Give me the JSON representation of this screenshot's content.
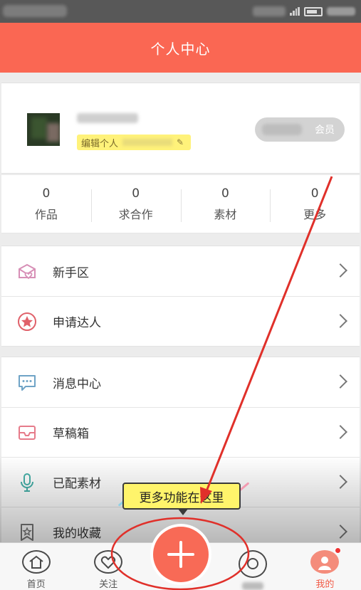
{
  "header": {
    "title": "个人中心"
  },
  "profile": {
    "member_label": "会员",
    "signature_prefix": "编辑个人"
  },
  "stats": [
    {
      "value": "0",
      "label": "作品"
    },
    {
      "value": "0",
      "label": "求合作"
    },
    {
      "value": "0",
      "label": "素材"
    },
    {
      "value": "0",
      "label": "更多"
    }
  ],
  "menu_group_1": [
    {
      "label": "新手区",
      "icon": "gift-box-heart-icon"
    },
    {
      "label": "申请达人",
      "icon": "star-badge-icon"
    }
  ],
  "menu_group_2": [
    {
      "label": "消息中心",
      "icon": "chat-bubble-icon"
    },
    {
      "label": "草稿箱",
      "icon": "inbox-tray-icon"
    },
    {
      "label": "已配素材",
      "icon": "microphone-icon"
    },
    {
      "label": "我的收藏",
      "icon": "bookmark-star-icon"
    }
  ],
  "tooltip": {
    "text": "更多功能在这里"
  },
  "tabbar": {
    "tabs": [
      {
        "label": "首页",
        "icon": "home-icon"
      },
      {
        "label": "关注",
        "icon": "heart-icon"
      },
      {
        "label": "",
        "icon": "plus-icon"
      },
      {
        "label": "",
        "icon": "circle-icon"
      },
      {
        "label": "我的",
        "icon": "profile-avatar-icon"
      }
    ]
  },
  "colors": {
    "accent": "#fa6753",
    "annotation": "#e0302a",
    "tooltip_bg": "#fff46b"
  }
}
